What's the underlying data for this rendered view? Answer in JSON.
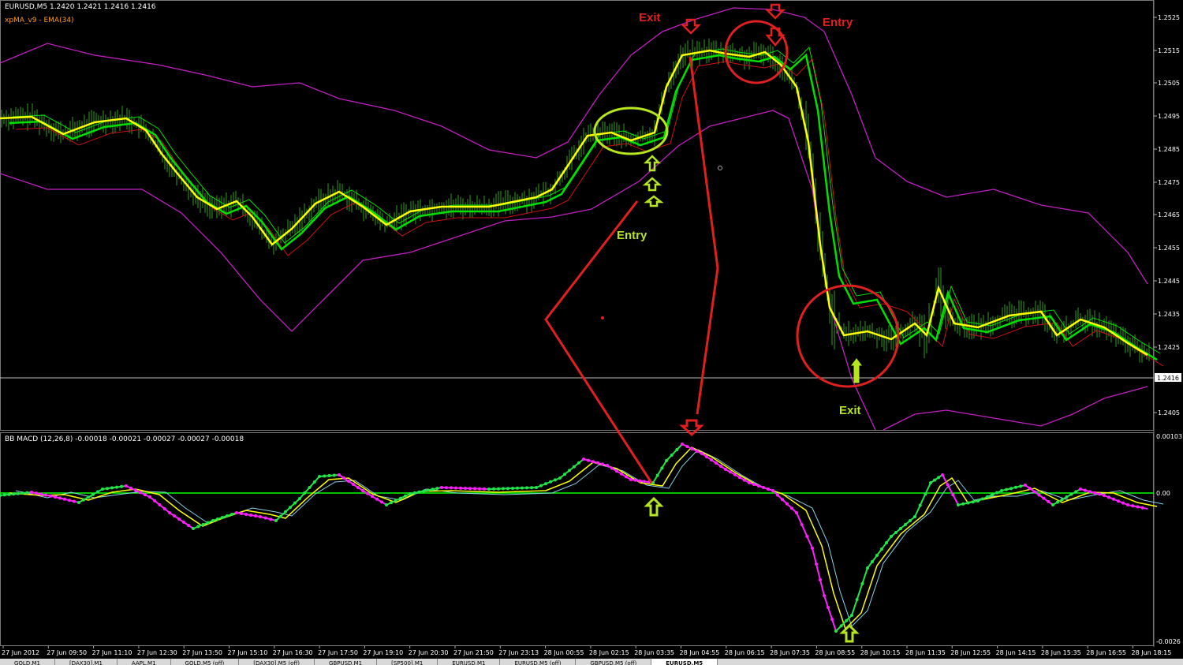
{
  "window": {
    "title": "EURUSD,M5  1.2420 1.2421 1.2416 1.2416",
    "indicator": "xpMA_v9 - EMA(34)",
    "macd_title": "BB MACD (12,26,8) -0.00018 -0.00021 -0.00027 -0.00027 -0.00018"
  },
  "colors": {
    "background": "#000000",
    "candles": "#2f9e1a",
    "xpma_yellow": "#ffff00",
    "ema_green": "#00e000",
    "ema_red": "#d01010",
    "bands": "#c21fc2",
    "annotation_red": "#e02020",
    "annotation_green": "#b5e61d",
    "macd_green": "#22e54a",
    "macd_magenta": "#ff20ff",
    "macd_signal_blue": "#8ad3e6",
    "zero_line": "#00ff00"
  },
  "price_axis": [
    "1.2525",
    "1.2515",
    "1.2505",
    "1.2495",
    "1.2485",
    "1.2475",
    "1.2465",
    "1.2455",
    "1.2445",
    "1.2435",
    "1.2425",
    "1.2405"
  ],
  "current_price": "1.2416",
  "macd_axis": [
    "0.00103",
    "0.00",
    "-0.0026"
  ],
  "time_axis": [
    "27 Jun 2012",
    "27 Jun 09:50",
    "27 Jun 11:10",
    "27 Jun 12:30",
    "27 Jun 13:50",
    "27 Jun 15:10",
    "27 Jun 16:30",
    "27 Jun 17:50",
    "27 Jun 19:10",
    "27 Jun 20:30",
    "27 Jun 21:50",
    "27 Jun 23:13",
    "28 Jun 00:55",
    "28 Jun 02:15",
    "28 Jun 03:35",
    "28 Jun 04:55",
    "28 Jun 06:15",
    "28 Jun 07:35",
    "28 Jun 08:55",
    "28 Jun 10:15",
    "28 Jun 11:35",
    "28 Jun 12:55",
    "28 Jun 14:15",
    "28 Jun 15:35",
    "28 Jun 16:55",
    "28 Jun 18:15"
  ],
  "annotations": {
    "exit_top": "Exit",
    "entry_top": "Entry",
    "entry_mid": "Entry",
    "exit_bottom": "Exit"
  },
  "tabs": [
    "GOLD,M1",
    "[DAX30],M1",
    "AAPL,M1",
    "GOLD,M5 (off)",
    "[DAX30],M5 (off)",
    "GBPUSD,M1",
    "[SP500],M1",
    "EURUSD,M1",
    "EURUSD,M5 (off)",
    "GBPUSD,M5 (off)",
    "EURUSD,M5"
  ],
  "active_tab": "EURUSD,M5"
}
